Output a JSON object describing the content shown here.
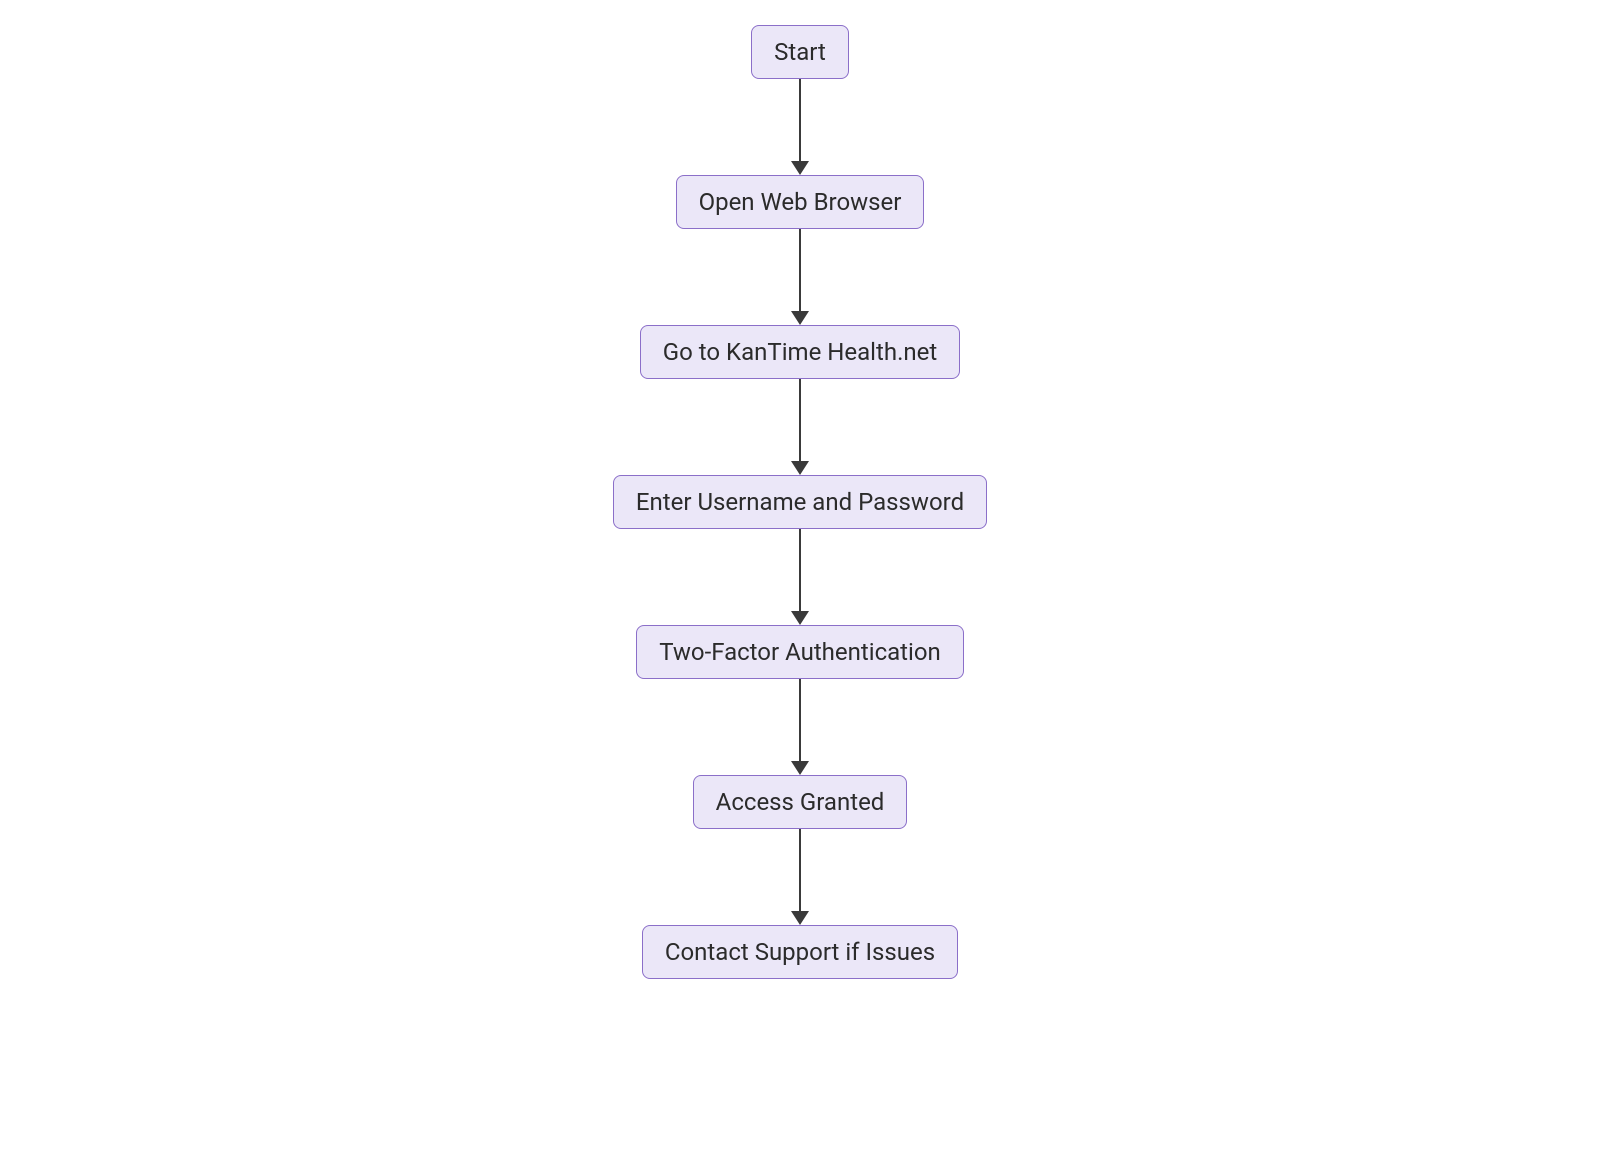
{
  "flowchart": {
    "nodes": [
      {
        "label": "Start"
      },
      {
        "label": "Open Web Browser"
      },
      {
        "label": "Go to KanTime Health.net"
      },
      {
        "label": "Enter Username and Password"
      },
      {
        "label": "Two-Factor Authentication"
      },
      {
        "label": "Access Granted"
      },
      {
        "label": "Contact Support if Issues"
      }
    ]
  },
  "colors": {
    "nodeFill": "#ebe7f8",
    "nodeBorder": "#8b6fc9",
    "text": "#2b2b2b",
    "arrow": "#3a3a3a"
  }
}
